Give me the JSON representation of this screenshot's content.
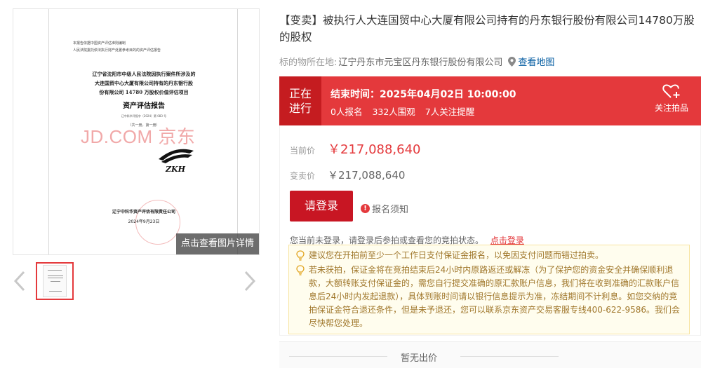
{
  "document": {
    "header_line1": "本报告依据中国资产评估准则编制",
    "header_line2": "人民法院委托依法执行财产处置参考目的的资产评估报告",
    "title_lines": [
      "辽宁省沈阳市中级人民法院因执行案件所涉及的",
      "大连国贸中心大厦有限公司持有的丹东银行股",
      "份有限公司 14780 万股权价值评估项目"
    ],
    "report_title": "资产评估报告",
    "report_code": "辽中科华评报字（2024）第 083 号",
    "volume": "（共一册，第一册）",
    "watermark": "JD.COM 京东",
    "logo_text": "ZKH",
    "org": "辽宁中科华资产评估有限责任公司",
    "date": "2024年9月23日"
  },
  "viewer": {
    "detail_button": "点击查看图片详情"
  },
  "header": {
    "title": "【变卖】被执行人大连国贸中心大厦有限公司持有的丹东银行股份有限公司14780万股的股权",
    "location_label": "标的物所在地:",
    "location_value": "辽宁丹东市元宝区丹东银行股份有限公司",
    "map_link": "查看地图"
  },
  "status": {
    "badge_line1": "正在",
    "badge_line2": "进行",
    "end_time": "结束时间：2025年04月02日 10:00:00",
    "signups": "0人报名",
    "views": "332人围观",
    "followers": "7人关注提醒",
    "follow_label": "关注拍品"
  },
  "price": {
    "current_label": "当前价",
    "current_value": "￥217,088,640",
    "sale_label": "变卖价",
    "sale_value": "￥217,088,640",
    "login_button": "请登录",
    "notice_link": "报名须知",
    "notice_icon": "!",
    "login_hint": "您当前未登录，请登录后参拍或查看您的竞拍状态。",
    "login_hint_link": "点击登录"
  },
  "tips": [
    "建议您在开拍前至少一个工作日支付保证金报名，以免因支付问题而错过拍卖。",
    "若未获拍，保证金将在竞拍结束后24小时内原路返还或解冻（为了保护您的资金安全并确保顺利退款，大额转账支付保证金的，需您自行提交准确的原汇款账户信息，我们将在收到准确的汇款账户信息后24小时内发起退款），具体到账时间请以银行信息提示为准，冻结期间不计利息。如您交纳的竞拍保证金符合退还条件，但是未予退还，您可以联系京东资产交易客服专线400-622-9586。我们会尽快帮您处理。"
  ],
  "bids": {
    "empty_text": "暂无出价"
  },
  "colors": {
    "accent_red": "#e4393c",
    "badge_red": "#c51c20",
    "button_red": "#c81623",
    "tip_bg": "#fffdee",
    "tip_text": "#a0772b",
    "link_blue": "#005aa0"
  }
}
